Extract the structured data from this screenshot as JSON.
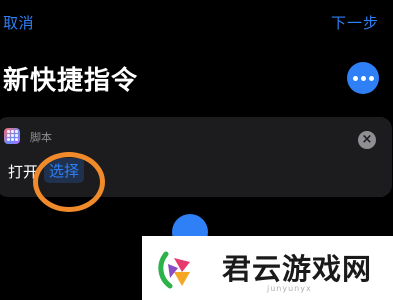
{
  "nav": {
    "cancel_label": "取消",
    "next_label": "下一步"
  },
  "page": {
    "title": "新快捷指令"
  },
  "action_card": {
    "category": "脚本",
    "verb": "打开",
    "parameter": "选择"
  },
  "watermark": {
    "brand": "君云游戏网",
    "url": "junyunyx"
  },
  "colors": {
    "accent": "#2f7ff6",
    "card_background": "#1c1c1e",
    "highlight_ring": "#f08a2b"
  }
}
